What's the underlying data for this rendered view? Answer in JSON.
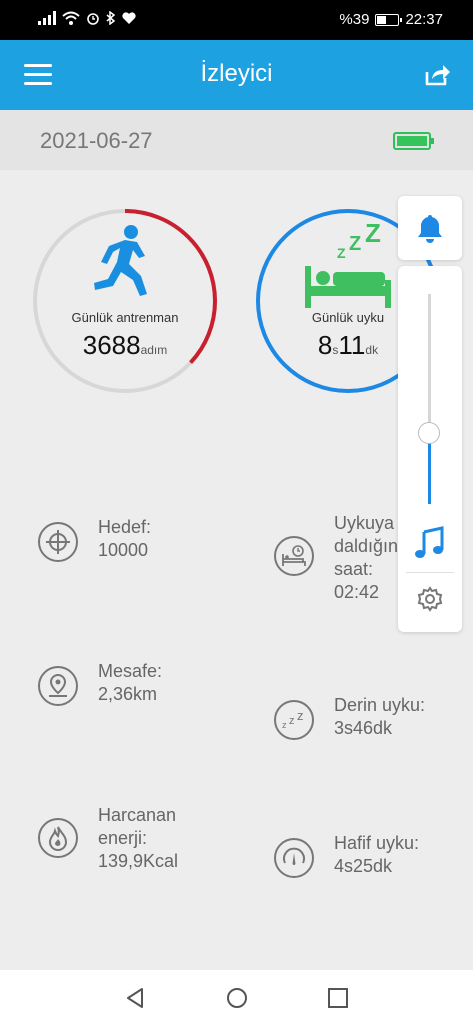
{
  "status_bar": {
    "battery_text": "%39",
    "time": "22:37",
    "icons": [
      "signal-icon",
      "wifi-icon",
      "alarm-icon",
      "bluetooth-icon",
      "heart-icon"
    ]
  },
  "app_bar": {
    "title": "İzleyici",
    "menu_icon": "hamburger-menu-icon",
    "share_icon": "share-icon"
  },
  "date_bar": {
    "date": "2021-06-27",
    "device_battery_icon": "battery-full-icon",
    "device_battery_color": "#35c45c"
  },
  "training_ring": {
    "label": "Günlük antrenman",
    "value": "3688",
    "unit": "adım",
    "progress_fraction": 0.37,
    "color": "#c8202e",
    "icon": "runner-icon"
  },
  "sleep_ring": {
    "label": "Günlük uyku",
    "hours": "8",
    "hours_unit": "s",
    "minutes": "11",
    "minutes_unit": "dk",
    "icon": "sleeping-bed-icon",
    "color": "#1e88e5"
  },
  "stats": {
    "target": {
      "line1": "Hedef:",
      "line2": "10000",
      "icon": "target-icon"
    },
    "distance": {
      "line1": "Mesafe:",
      "line2": "2,36km",
      "icon": "location-pin-icon"
    },
    "energy": {
      "line1": "Harcanan",
      "line2": "enerji:",
      "line3": "139,9Kcal",
      "icon": "flame-icon"
    },
    "fall_asleep": {
      "line1": "Uykuya",
      "line2": "daldığınız",
      "line3": "saat:",
      "line4": "02:42",
      "icon": "bed-clock-icon"
    },
    "deep_sleep": {
      "line1": "Derin uyku:",
      "line2": "3s46dk",
      "icon": "zzz-icon"
    },
    "light_sleep": {
      "line1": "Hafif uyku:",
      "line2": "4s25dk",
      "icon": "gauge-icon"
    }
  },
  "volume_panel": {
    "bell_icon": "bell-icon",
    "level_fraction": 0.34,
    "music_icon": "music-note-icon",
    "settings_icon": "gear-icon",
    "accent": "#1e88e5"
  },
  "nav_bar": {
    "back_icon": "back-triangle-icon",
    "home_icon": "home-circle-icon",
    "recents_icon": "recents-square-icon"
  }
}
